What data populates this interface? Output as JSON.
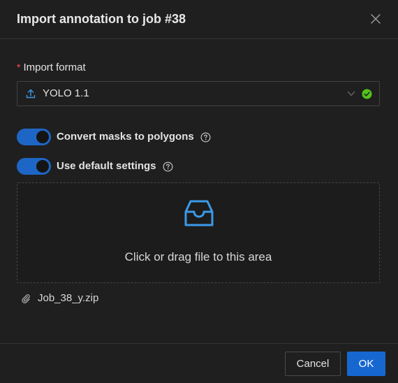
{
  "dialog": {
    "title": "Import annotation to job #38"
  },
  "form": {
    "format_label": "Import format",
    "required_mark": "*",
    "format_value": "YOLO 1.1",
    "format_valid": true
  },
  "switches": [
    {
      "label": "Convert masks to polygons",
      "checked": true
    },
    {
      "label": "Use default settings",
      "checked": true
    }
  ],
  "dropzone": {
    "text": "Click or drag file to this area"
  },
  "files": [
    {
      "name": "Job_38_y.zip"
    }
  ],
  "footer": {
    "cancel_label": "Cancel",
    "ok_label": "OK"
  },
  "colors": {
    "accent": "#1668d0",
    "switch_on": "#1e66c5",
    "success": "#52c41a",
    "required": "#ff4d4f",
    "icon_blue": "#3c9ae8"
  },
  "icons": {
    "close": "close-icon",
    "upload": "upload-icon",
    "chevron": "chevron-down-icon",
    "check": "check-circle-icon",
    "help": "question-circle-icon",
    "inbox": "inbox-icon",
    "paperclip": "paperclip-icon"
  }
}
